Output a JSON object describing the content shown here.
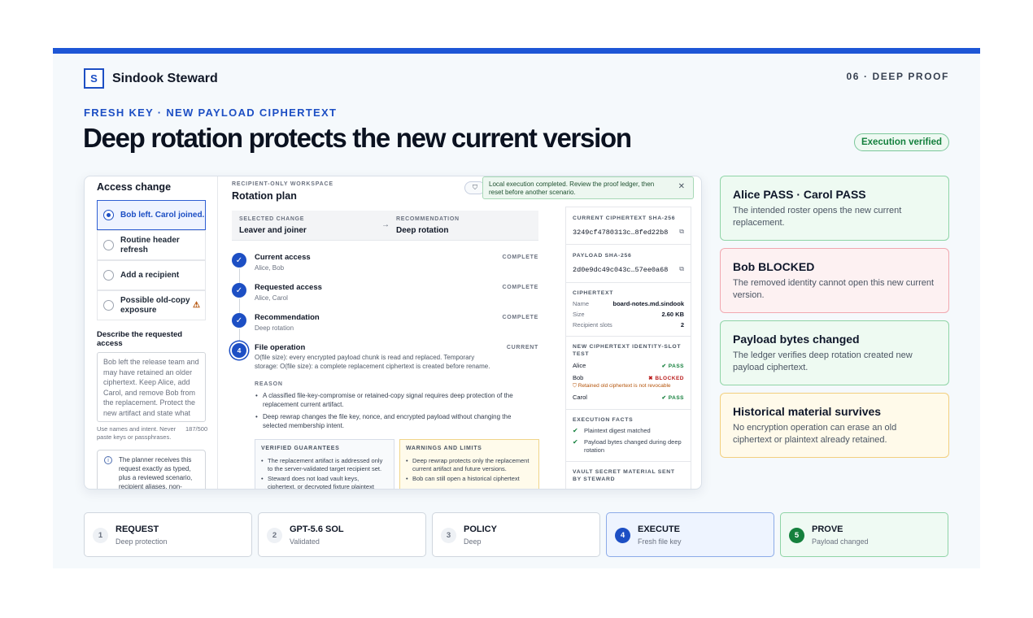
{
  "brand": {
    "logo_letter": "S",
    "name": "Sindook Steward"
  },
  "slide": {
    "number_label": "06 · DEEP PROOF",
    "eyebrow": "FRESH KEY · NEW PAYLOAD CIPHERTEXT",
    "headline": "Deep rotation protects the new current version",
    "badge": "Execution verified"
  },
  "access_panel": {
    "title": "Access change",
    "options": [
      {
        "label": "Bob left. Carol joined.",
        "selected": true
      },
      {
        "label": "Routine header refresh",
        "selected": false
      },
      {
        "label": "Add a recipient",
        "selected": false
      },
      {
        "label": "Possible old-copy exposure",
        "selected": false,
        "warning": true
      }
    ],
    "describe_label": "Describe the requested access",
    "describe_text": "Bob left the release team and may have retained an older ciphertext. Keep Alice, add Carol, and remove Bob from the replacement. Protect the new artifact and state what",
    "hint": "Use names and intent. Never paste keys or passphrases.",
    "char_count": "187/500",
    "info_text": "The planner receives this request exactly as typed, plus a reviewed scenario, recipient aliases, non-"
  },
  "plan": {
    "kicker": "RECIPIENT-ONLY WORKSPACE",
    "title": "Rotation plan",
    "selected_change_label": "SELECTED CHANGE",
    "selected_change_value": "Leaver and joiner",
    "recommendation_label": "RECOMMENDATION",
    "recommendation_value": "Deep rotation",
    "steps": [
      {
        "title": "Current access",
        "sub": "Alice, Bob",
        "status": "COMPLETE"
      },
      {
        "title": "Requested access",
        "sub": "Alice, Carol",
        "status": "COMPLETE"
      },
      {
        "title": "Recommendation",
        "sub": "Deep rotation",
        "status": "COMPLETE"
      },
      {
        "number": "4",
        "title": "File operation",
        "sub": "O(file size): every encrypted payload chunk is read and replaced. Temporary storage: O(file size): a complete replacement ciphertext is created before rename.",
        "status": "CURRENT"
      }
    ],
    "reason_label": "REASON",
    "reasons": [
      "A classified file-key-compromise or retained-copy signal requires deep protection of the replacement current artifact.",
      "Deep rewrap changes the file key, nonce, and encrypted payload without changing the selected membership intent."
    ],
    "guarantees_label": "VERIFIED GUARANTEES",
    "guarantees": [
      "The replacement artifact is addressed only to the server-validated target recipient set.",
      "Steward does not load vault keys, ciphertext, or decrypted fixture plaintext"
    ],
    "warnings_label": "WARNINGS AND LIMITS",
    "warnings": [
      "Deep rewrap protects only the replacement current artifact and future versions.",
      "Bob can still open a historical ciphertext"
    ]
  },
  "toast": {
    "text": "Local execution completed. Review the proof ledger, then reset before another scenario."
  },
  "ledger": {
    "ciphertext_sha_label": "CURRENT CIPHERTEXT SHA-256",
    "ciphertext_sha": "3249cf4780313c…8fed22b8",
    "payload_sha_label": "PAYLOAD SHA-256",
    "payload_sha": "2d0e9dc49c043c…57ee0a68",
    "ciphertext_label": "CIPHERTEXT",
    "ciphertext_rows": [
      {
        "k": "Name",
        "v": "board-notes.md.sindook"
      },
      {
        "k": "Size",
        "v": "2.60 KB"
      },
      {
        "k": "Recipient slots",
        "v": "2"
      }
    ],
    "slot_test_label": "NEW CIPHERTEXT IDENTITY-SLOT TEST",
    "slots": [
      {
        "name": "Alice",
        "result": "PASS"
      },
      {
        "name": "Bob",
        "result": "BLOCKED"
      },
      {
        "name": "Carol",
        "result": "PASS"
      }
    ],
    "bob_note": "Retained old ciphertext is not revocable",
    "facts_label": "EXECUTION FACTS",
    "facts": [
      "Plaintext digest matched",
      "Payload bytes changed during deep rotation"
    ],
    "vault_label": "VAULT SECRET MATERIAL SENT BY STEWARD"
  },
  "result_cards": [
    {
      "title": "Alice PASS · Carol PASS",
      "desc": "The intended roster opens the new current replacement.",
      "border": "#8fd4a6",
      "bg": "#eefaf2"
    },
    {
      "title": "Bob BLOCKED",
      "desc": "The removed identity cannot open this new current version.",
      "border": "#f1a8b0",
      "bg": "#fdf1f2"
    },
    {
      "title": "Payload bytes changed",
      "desc": "The ledger verifies deep rotation created new payload ciphertext.",
      "border": "#8fd4a6",
      "bg": "#eefaf2"
    },
    {
      "title": "Historical material survives",
      "desc": "No encryption operation can erase an old ciphertext or plaintext already retained.",
      "border": "#f2cf7e",
      "bg": "#fffaea"
    }
  ],
  "pipeline": [
    {
      "n": "1",
      "title": "REQUEST",
      "sub": "Deep protection"
    },
    {
      "n": "2",
      "title": "GPT-5.6 SOL",
      "sub": "Validated"
    },
    {
      "n": "3",
      "title": "POLICY",
      "sub": "Deep"
    },
    {
      "n": "4",
      "title": "EXECUTE",
      "sub": "Fresh file key",
      "state": "active"
    },
    {
      "n": "5",
      "title": "PROVE",
      "sub": "Payload changed",
      "state": "done"
    }
  ],
  "colors": {
    "accent": "#1d56d6",
    "pass": "#15803d",
    "blocked": "#b91c1c",
    "warning": "#b45309"
  }
}
